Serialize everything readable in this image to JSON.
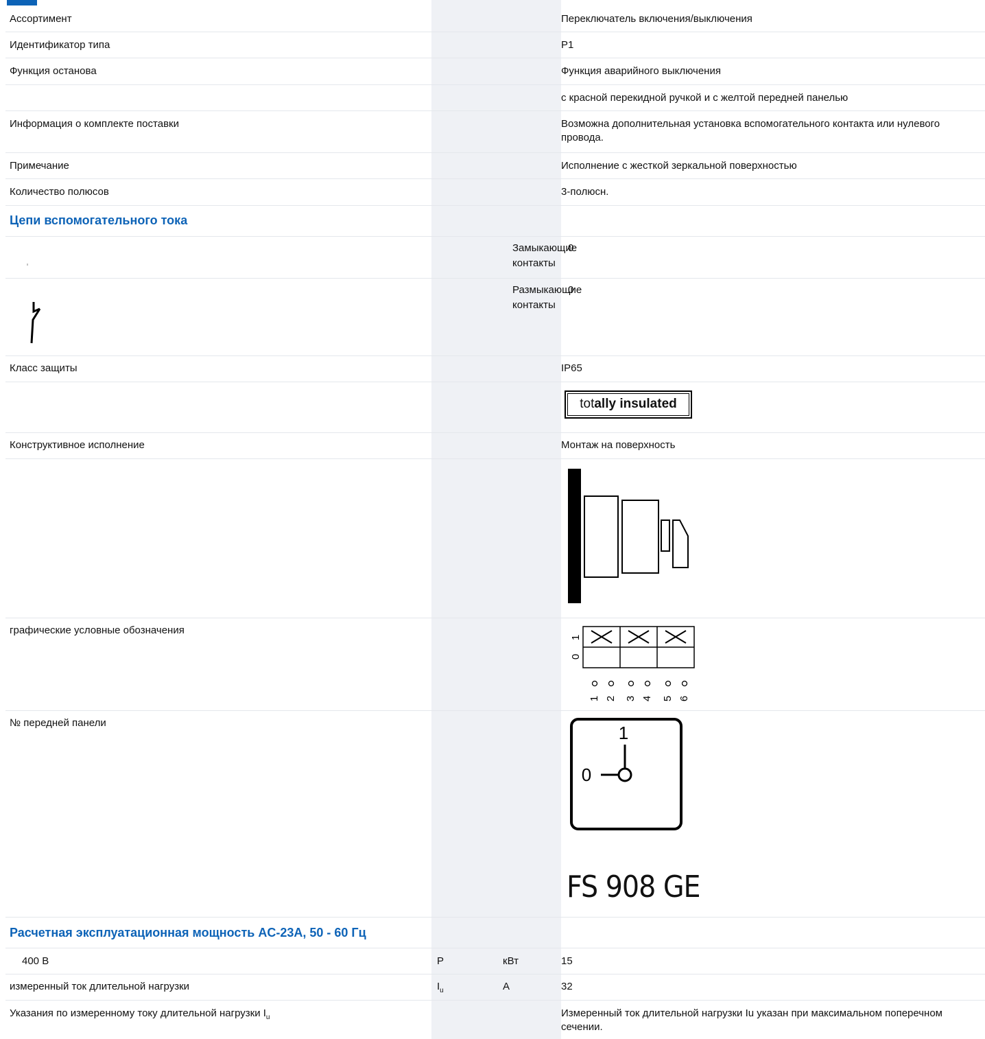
{
  "rows": {
    "assortment": {
      "label": "Ассортимент",
      "value": "Переключатель включения/выключения"
    },
    "type_id": {
      "label": "Идентификатор типа",
      "value": "P1"
    },
    "stop_function": {
      "label": "Функция останова",
      "value": "Функция аварийного выключения"
    },
    "stop_function_extra": {
      "value": "с красной перекидной ручкой и с желтой передней панелью"
    },
    "delivery": {
      "label": "Информация о комплекте поставки",
      "value": "Возможна дополнительная установка вспомогательного контакта или нулевого провода."
    },
    "note": {
      "label": "Примечание",
      "value": "Исполнение с жесткой зеркальной поверхностью"
    },
    "poles": {
      "label": "Количество полюсов",
      "value": "3-полюсн."
    },
    "protection": {
      "label": "Класс защиты",
      "value": "IP65"
    },
    "design": {
      "label": "Конструктивное исполнение",
      "value": "Монтаж на поверхность"
    },
    "symbols": {
      "label": "графические условные обозначения"
    },
    "front_panel": {
      "label": "№ передней панели"
    },
    "rated_400": {
      "label": "400 В",
      "symbol": "P",
      "unit": "кВт",
      "value": "15"
    },
    "current": {
      "label": "измеренный ток длительной нагрузки",
      "symbol_main": "I",
      "symbol_sub": "u",
      "unit": "A",
      "value": "32"
    },
    "current_note": {
      "label_main": "Указания по измеренному току длительной нагрузки I",
      "label_sub": "u",
      "value": "Измеренный ток длительной нагрузки Iu указан при максимальном поперечном сечении."
    }
  },
  "sections": {
    "aux": "Цепи вспомогательного тока",
    "power": "Расчетная эксплуатационная мощность AC-23A, 50 - 60 Гц"
  },
  "aux_contacts": {
    "no_label": "Замыкающие контакты",
    "no_value": "0",
    "nc_label": "Размыкающие контакты",
    "nc_value": "0"
  },
  "badge": {
    "part1": "tot",
    "part2": "ally",
    "part3": " ",
    "part4": "insulated"
  },
  "switch_diagram": {
    "positions": [
      "0",
      "1"
    ],
    "terminals": [
      "1",
      "2",
      "3",
      "4",
      "5",
      "6"
    ]
  },
  "front_plate": {
    "pos_top": "1",
    "pos_left": "0",
    "code": "FS 908 GE"
  }
}
